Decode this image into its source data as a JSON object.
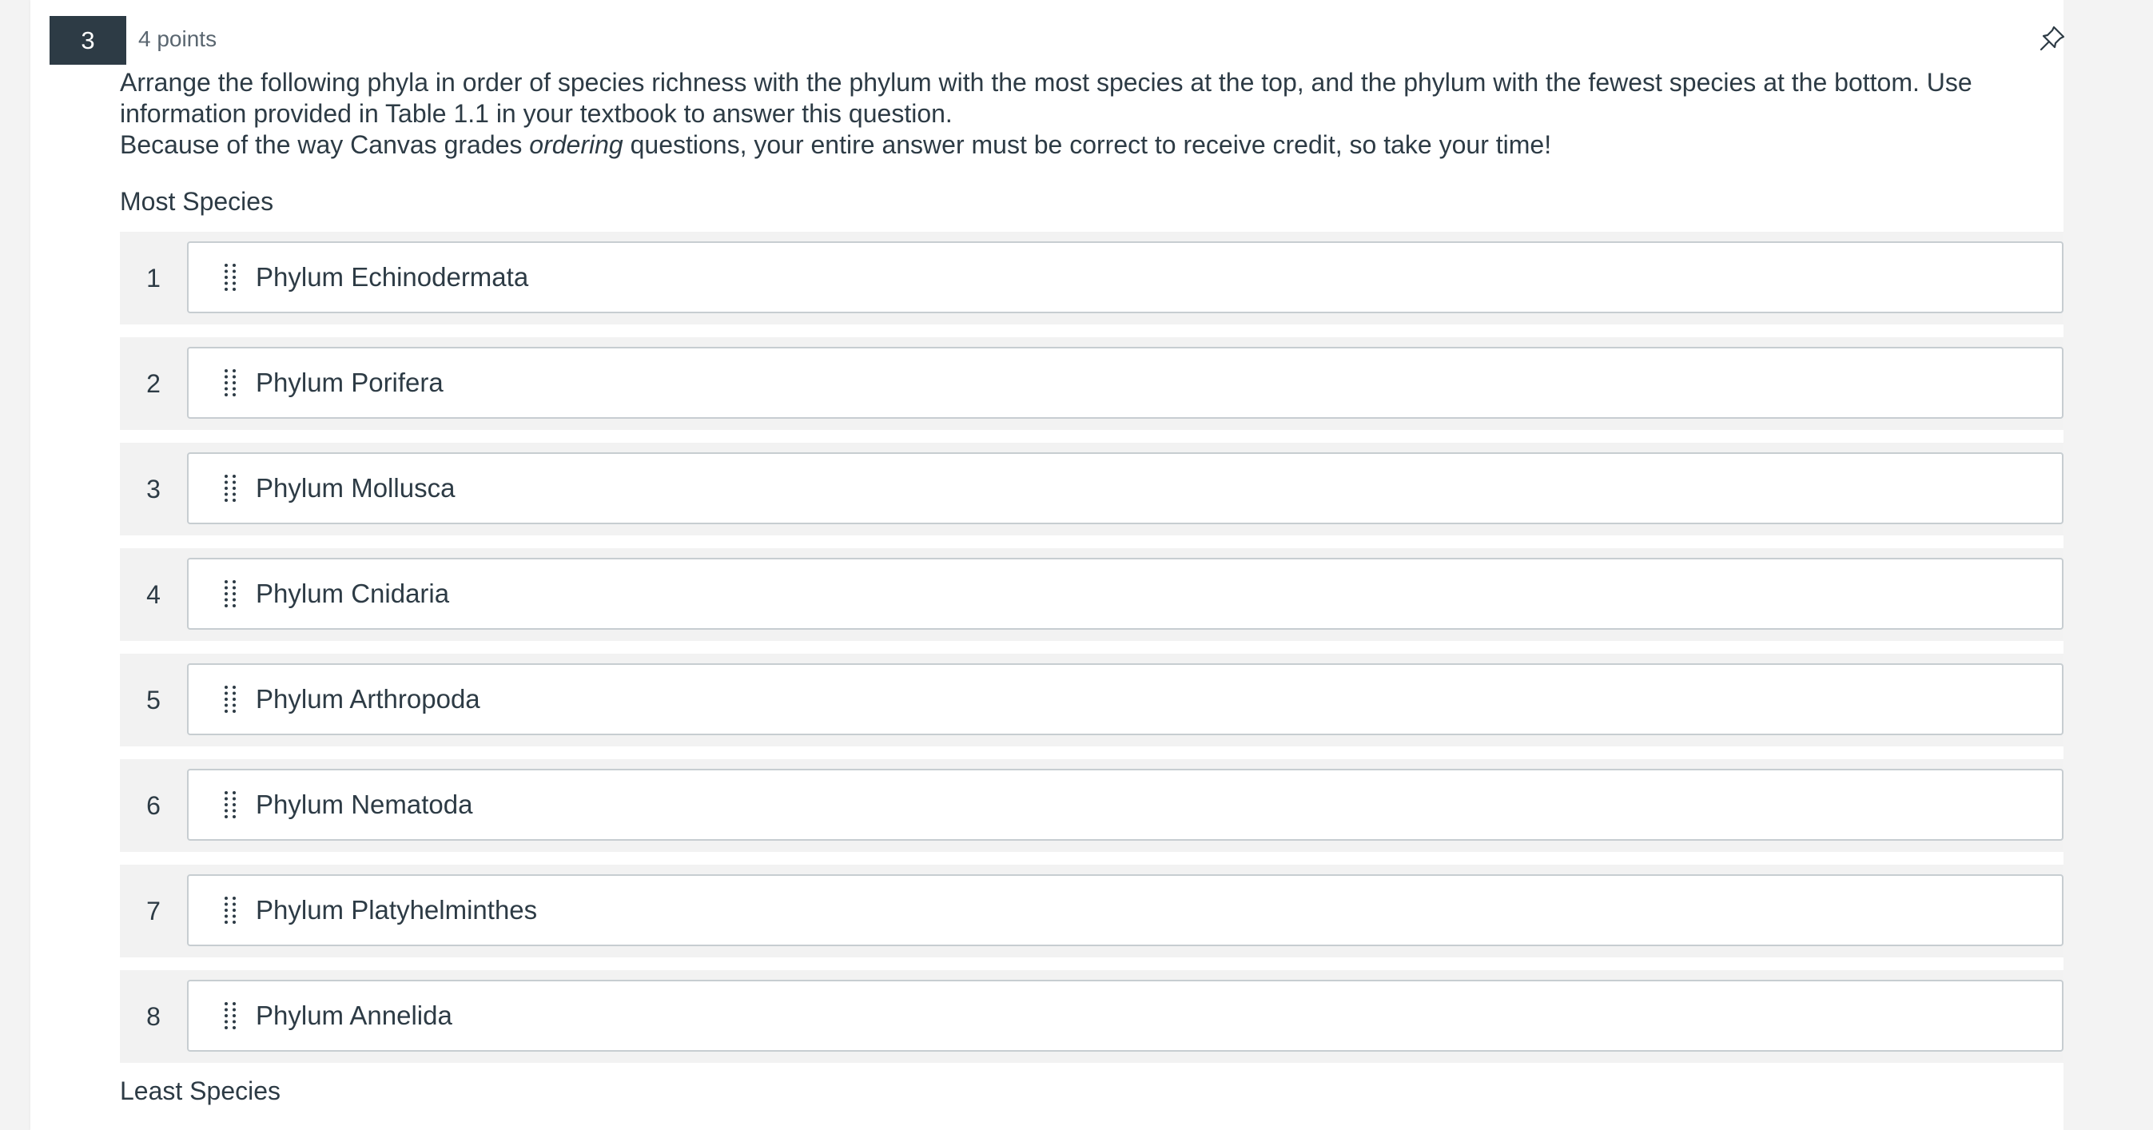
{
  "question": {
    "number": "3",
    "points": "4 points",
    "prompt_line1": "Arrange the following phyla in order of species richness with the phylum with the most species at the top, and the phylum with the fewest species at the bottom. Use information provided in Table 1.1 in your textbook to answer this question.",
    "prompt_line2_before": "Because of the way Canvas grades ",
    "prompt_line2_emphasis": "ordering",
    "prompt_line2_after": " questions, your entire answer must be correct to receive credit, so take your time!",
    "top_label": "Most Species",
    "bottom_label": "Least Species",
    "pin_icon": "pin-icon",
    "drag_icon": "drag-handle-icon"
  },
  "items": [
    {
      "index": "1",
      "label": "Phylum Echinodermata"
    },
    {
      "index": "2",
      "label": "Phylum Porifera"
    },
    {
      "index": "3",
      "label": "Phylum Mollusca"
    },
    {
      "index": "4",
      "label": "Phylum Cnidaria"
    },
    {
      "index": "5",
      "label": "Phylum Arthropoda"
    },
    {
      "index": "6",
      "label": "Phylum Nematoda"
    },
    {
      "index": "7",
      "label": "Phylum Platyhelminthes"
    },
    {
      "index": "8",
      "label": "Phylum Annelida"
    }
  ],
  "colors": {
    "badge_bg": "#2d3b45",
    "text": "#2d3b45",
    "row_bg": "#f2f2f2",
    "item_border": "#c7cdd1"
  }
}
